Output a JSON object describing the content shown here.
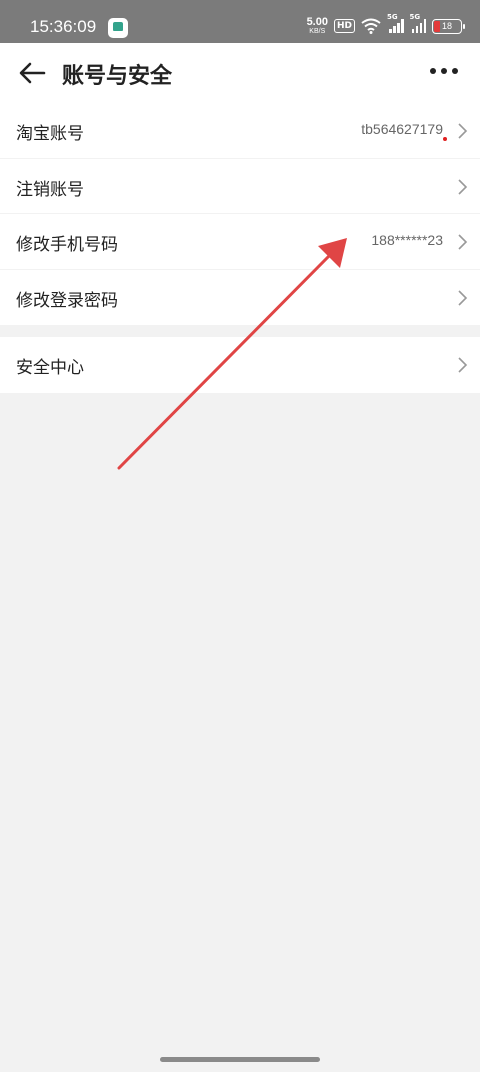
{
  "status_bar": {
    "time": "15:36:09",
    "net_speed_value": "5.00",
    "net_speed_unit": "KB/S",
    "hd_label": "HD",
    "signal_1_label": "5G",
    "signal_2_label": "5G",
    "battery_level": "18",
    "battery_color": "#e23b3b"
  },
  "header": {
    "title": "账号与安全",
    "back_icon": "arrow-left-icon",
    "more_icon": "more-dots-icon"
  },
  "rows": [
    {
      "label": "淘宝账号",
      "value": "tb564627179"
    },
    {
      "label": "注销账号",
      "value": ""
    },
    {
      "label": "修改手机号码",
      "value": "188******23"
    },
    {
      "label": "修改登录密码",
      "value": ""
    }
  ],
  "security_row": {
    "label": "安全中心"
  },
  "annotation": {
    "color": "#e04545",
    "icon": "red-arrow-annotation"
  }
}
